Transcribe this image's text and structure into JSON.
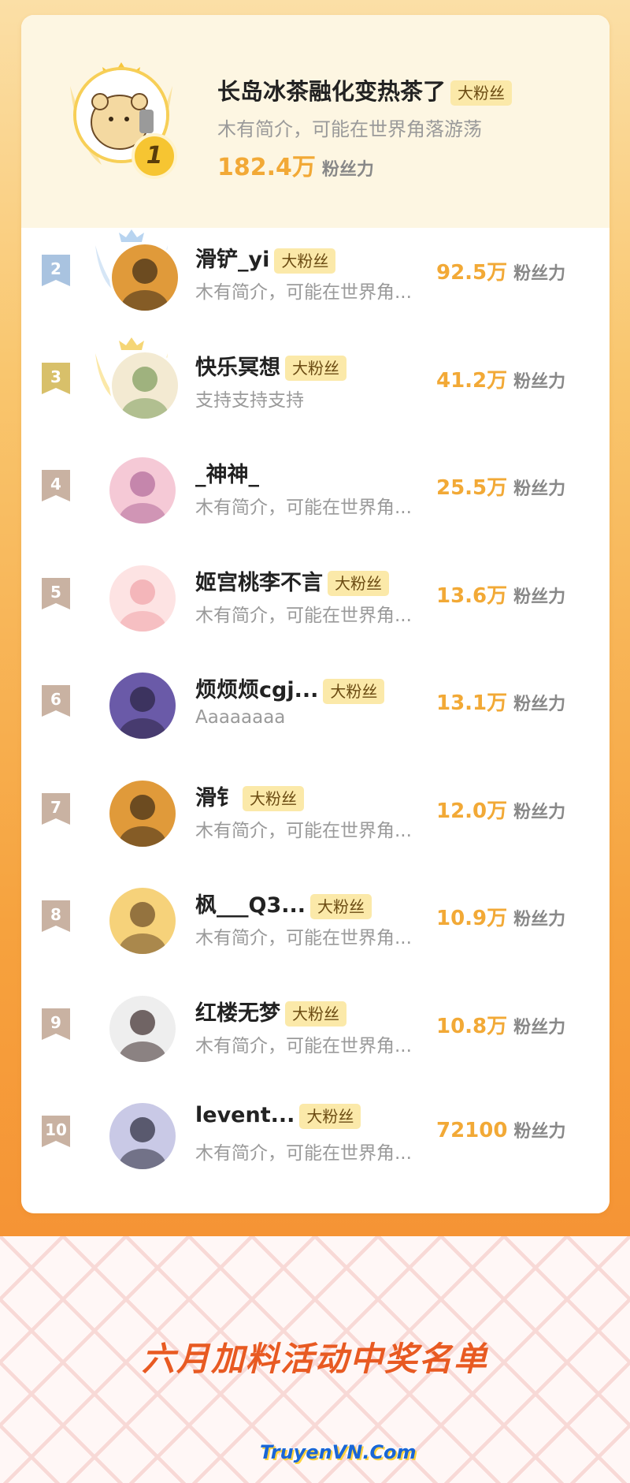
{
  "first": {
    "rank": "1",
    "name": "长岛冰茶融化变热茶了",
    "badge": "大粉丝",
    "bio": "木有简介，可能在世界角落游荡",
    "fans": "182.4万",
    "fans_unit": "粉丝力"
  },
  "rows": [
    {
      "rank": "2",
      "name": "滑铲_yi",
      "badge": "大粉丝",
      "bio": "木有简介，可能在世界角...",
      "fans": "92.5万",
      "fans_unit": "粉丝力"
    },
    {
      "rank": "3",
      "name": "快乐冥想",
      "badge": "大粉丝",
      "bio": "支持支持支持",
      "fans": "41.2万",
      "fans_unit": "粉丝力"
    },
    {
      "rank": "4",
      "name": "_神神_",
      "badge": "",
      "bio": "木有简介，可能在世界角...",
      "fans": "25.5万",
      "fans_unit": "粉丝力"
    },
    {
      "rank": "5",
      "name": "姬宫桃李不言",
      "badge": "大粉丝",
      "bio": "木有简介，可能在世界角...",
      "fans": "13.6万",
      "fans_unit": "粉丝力"
    },
    {
      "rank": "6",
      "name": "烦烦烦cgj...",
      "badge": "大粉丝",
      "bio": "Aaaaaaaa",
      "fans": "13.1万",
      "fans_unit": "粉丝力"
    },
    {
      "rank": "7",
      "name": "滑钅",
      "badge": "大粉丝",
      "bio": "木有简介，可能在世界角...",
      "fans": "12.0万",
      "fans_unit": "粉丝力"
    },
    {
      "rank": "8",
      "name": "枫___Q3...",
      "badge": "大粉丝",
      "bio": "木有简介，可能在世界角...",
      "fans": "10.9万",
      "fans_unit": "粉丝力"
    },
    {
      "rank": "9",
      "name": "红楼无梦",
      "badge": "大粉丝",
      "bio": "木有简介，可能在世界角...",
      "fans": "10.8万",
      "fans_unit": "粉丝力"
    },
    {
      "rank": "10",
      "name": "levent...",
      "badge": "大粉丝",
      "bio": "木有简介，可能在世界角...",
      "fans": "72100",
      "fans_unit": "粉丝力"
    }
  ],
  "footer": {
    "title": "六月加料活动中奖名单",
    "logo": "TruyenVN.Com"
  },
  "colors": {
    "accent": "#f2a936",
    "rank2": "#a9c3e0",
    "rank3": "#d8c06a",
    "rank_other": "#c9b2a2"
  }
}
